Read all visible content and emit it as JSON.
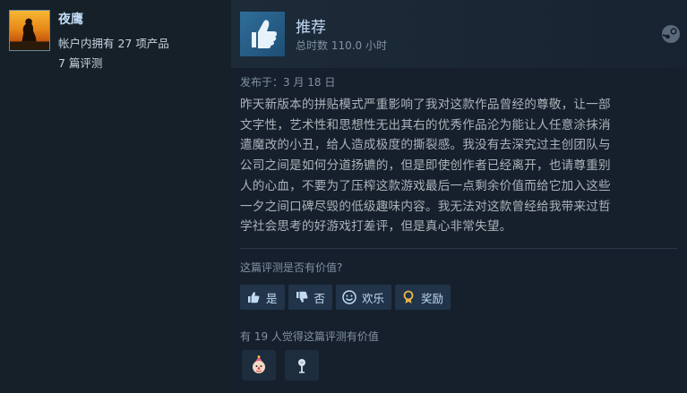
{
  "user": {
    "name": "夜鹰",
    "products_owned": "帐户内拥有 27 项产品",
    "reviews_count": "7 篇评测"
  },
  "review": {
    "recommendation": "推荐",
    "hours": "总时数 110.0 小时",
    "posted": "发布于：3 月 18 日",
    "body_lines": [
      "昨天新版本的拼贴模式严重影响了我对这款作品曾经的尊敬，让一部",
      "文字性，艺术性和思想性无出其右的优秀作品沦为能让人任意涂抹消",
      "遣魔改的小丑，给人造成极度的撕裂感。我没有去深究过主创团队与",
      "公司之间是如何分道扬镳的，但是即使创作者已经离开，也请尊重别",
      "人的心血，不要为了压榨这款游戏最后一点剩余价值而给它加入这些",
      "一夕之间口碑尽毁的低级趣味内容。我无法对这款曾经给我带来过哲",
      "学社会思考的好游戏打差评，但是真心非常失望。"
    ]
  },
  "feedback": {
    "question": "这篇评测是否有价值?",
    "buttons": {
      "yes": "是",
      "no": "否",
      "funny": "欢乐",
      "award": "奖励"
    },
    "helpful_count": "有 19 人觉得这篇评测有价值"
  },
  "colors": {
    "background": "#1b2838",
    "accent": "#66c0f4",
    "title": "#c1dbf4",
    "muted": "#8091a2"
  }
}
